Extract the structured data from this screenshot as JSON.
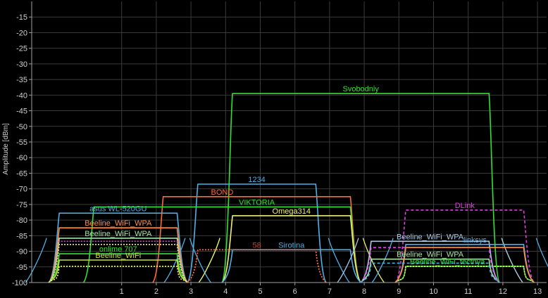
{
  "window": {
    "background": "#000000",
    "axis_color": "#A0A0A0",
    "grid_color": "#3A3A3A",
    "text_color": "#D0D0D0"
  },
  "chart_data": {
    "type": "line",
    "title": "",
    "xlabel": "",
    "ylabel": "Amplitude [dBm]",
    "xlim": [
      -1,
      13
    ],
    "ylim": [
      -100,
      -10
    ],
    "yticks": [
      -15,
      -20,
      -25,
      -30,
      -35,
      -40,
      -45,
      -50,
      -55,
      -60,
      -65,
      -70,
      -75,
      -80,
      -85,
      -90,
      -95,
      -100
    ],
    "xticks": [
      1,
      2,
      3,
      4,
      5,
      6,
      7,
      8,
      9,
      10,
      11,
      12,
      13
    ],
    "grid": true,
    "networks": [
      {
        "name": "Svobodniy",
        "color": "#33E033",
        "ch_start": 4.2,
        "ch_end": 11.6,
        "dbm": -39.5,
        "style": "solid",
        "label_x": 7.9,
        "shoulders": true
      },
      {
        "name": "1234",
        "color": "#4FB0E8",
        "ch_start": 3.2,
        "ch_end": 6.6,
        "dbm": -68.5,
        "style": "solid",
        "label_x": 4.9,
        "shoulders": true
      },
      {
        "name": "BOND",
        "color": "#FF6A3A",
        "ch_start": 2.2,
        "ch_end": 7.6,
        "dbm": -72.5,
        "style": "solid",
        "label_x": 3.9,
        "shoulders": false
      },
      {
        "name": "VIKTORIA",
        "color": "#33E033",
        "ch_start": 0.2,
        "ch_end": 7.6,
        "dbm": -75.8,
        "style": "solid",
        "label_x": 4.9,
        "shoulders": false
      },
      {
        "name": "asus WL-520GU",
        "color": "#4FB0E8",
        "ch_start": -0.8,
        "ch_end": 2.6,
        "dbm": -77.8,
        "style": "solid",
        "label_x": 0.9,
        "shoulders": true
      },
      {
        "name": "Omega314",
        "color": "#F0F070",
        "ch_start": 4.2,
        "ch_end": 7.6,
        "dbm": -78.6,
        "style": "solid",
        "label_x": 5.9,
        "shoulders": true
      },
      {
        "name": "DLink",
        "color": "#E040E0",
        "ch_start": 9.2,
        "ch_end": 12.6,
        "dbm": -76.8,
        "style": "dashed",
        "label_x": 10.9,
        "shoulders": false
      },
      {
        "name": "Beeline_WiFi_WPA",
        "color": "#FF8C40",
        "ch_start": -0.8,
        "ch_end": 2.6,
        "dbm": -82.5,
        "style": "solid",
        "label_x": 0.9,
        "shoulders": false
      },
      {
        "name": "Beeline_WiFi_WPA",
        "color": "#A8E0A8",
        "ch_start": -0.8,
        "ch_end": 2.6,
        "dbm": -85.8,
        "style": "solid",
        "label_x": 0.9,
        "shoulders": false
      },
      {
        "name": "onlime 707",
        "color": "#33E033",
        "ch_start": -0.8,
        "ch_end": 2.6,
        "dbm": -90.8,
        "style": "solid",
        "label_x": 0.9,
        "shoulders": false
      },
      {
        "name": "Beeline_WiFi",
        "color": "#C8E040",
        "ch_start": -0.8,
        "ch_end": 2.6,
        "dbm": -92.8,
        "style": "solid",
        "label_x": 0.9,
        "shoulders": false
      },
      {
        "name": "58",
        "color": "#D04020",
        "ch_start": 3.2,
        "ch_end": 6.6,
        "dbm": -89.5,
        "style": "dotted",
        "label_x": 4.9,
        "shoulders": false
      },
      {
        "name": "Sirotina",
        "color": "#4FB0E8",
        "ch_start": 4.2,
        "ch_end": 7.6,
        "dbm": -89.5,
        "style": "solid",
        "label_x": 5.9,
        "shoulders": false
      },
      {
        "name": "Beeline_WiFi_WPA",
        "color": "#A8C8E8",
        "ch_start": 8.2,
        "ch_end": 11.6,
        "dbm": -86.8,
        "style": "solid",
        "label_x": 9.9,
        "shoulders": true
      },
      {
        "name": "linksys",
        "color": "#4FB0E8",
        "ch_start": 9.2,
        "ch_end": 12.6,
        "dbm": -87.8,
        "style": "solid",
        "label_x": 11.2,
        "shoulders": true
      },
      {
        "name": "Beeline_WiFi_WPA",
        "color": "#A8E0A8",
        "ch_start": 8.2,
        "ch_end": 11.6,
        "dbm": -92.5,
        "style": "solid",
        "label_x": 9.9,
        "shoulders": false
      },
      {
        "name": "Beeline_WiFi_tectnya",
        "color": "#33E033",
        "ch_start": 9.2,
        "ch_end": 12.6,
        "dbm": -94.8,
        "style": "solid",
        "label_x": 10.4,
        "shoulders": false
      },
      {
        "name": "",
        "color": "#F0F070",
        "ch_start": 9.2,
        "ch_end": 12.6,
        "dbm": -94.8,
        "style": "dotted",
        "label_x": 10.9,
        "shoulders": false
      },
      {
        "name": "",
        "color": "#E040E0",
        "ch_start": 8.2,
        "ch_end": 11.6,
        "dbm": -88.8,
        "style": "dashed",
        "label_x": 9.9,
        "shoulders": false
      },
      {
        "name": "",
        "color": "#FF8C40",
        "ch_start": 9.2,
        "ch_end": 12.6,
        "dbm": -88.8,
        "style": "solid",
        "label_x": 10.9,
        "shoulders": false
      },
      {
        "name": "",
        "color": "#E040E0",
        "ch_start": -0.8,
        "ch_end": 2.6,
        "dbm": -86.8,
        "style": "dotted",
        "label_x": 0.9,
        "shoulders": false
      },
      {
        "name": "",
        "color": "#F0F070",
        "ch_start": -0.8,
        "ch_end": 2.6,
        "dbm": -87.8,
        "style": "dotted",
        "label_x": 0.9,
        "shoulders": false
      },
      {
        "name": "",
        "color": "#FF6A3A",
        "ch_start": 3.2,
        "ch_end": 6.6,
        "dbm": -89.5,
        "style": "dotted",
        "label_x": 4.9,
        "shoulders": false
      },
      {
        "name": "",
        "color": "#F0F070",
        "ch_start": -0.8,
        "ch_end": 2.6,
        "dbm": -94.8,
        "style": "dotted",
        "label_x": 0.9,
        "shoulders": false
      },
      {
        "name": "",
        "color": "#4FB0E8",
        "ch_start": 8.2,
        "ch_end": 11.6,
        "dbm": -93.8,
        "style": "dashed",
        "label_x": 9.9,
        "shoulders": false
      }
    ]
  }
}
